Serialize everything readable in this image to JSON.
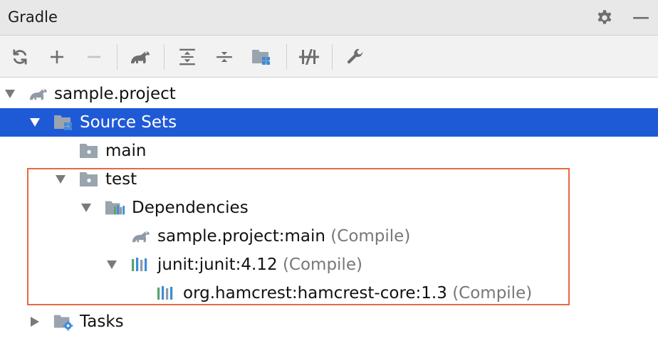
{
  "header": {
    "title": "Gradle",
    "buttons": [
      {
        "icon": "gear-icon"
      },
      {
        "icon": "minimize-icon"
      }
    ]
  },
  "toolbar": {
    "buttons": [
      {
        "icon": "refresh-icon"
      },
      {
        "icon": "add-icon"
      },
      {
        "icon": "remove-icon"
      },
      {
        "icon": "gradle-elephant-icon"
      },
      {
        "icon": "expand-all-icon"
      },
      {
        "icon": "collapse-all-icon"
      },
      {
        "icon": "group-modules-icon"
      },
      {
        "icon": "offline-mode-icon"
      },
      {
        "icon": "wrench-icon"
      }
    ]
  },
  "colors": {
    "selection": "#1f5ad6",
    "highlight_border": "#e8683f",
    "icon_gray": "#8f9aa6",
    "icon_blue": "#3f8bd8",
    "icon_green": "#5aa36c"
  },
  "tree": [
    {
      "label": "sample.project",
      "scope": "",
      "icon": "gradle-elephant-icon",
      "arrow": "expanded",
      "depth": 0
    },
    {
      "label": "Source Sets",
      "scope": "",
      "icon": "source-sets-folder-icon",
      "arrow": "expanded",
      "depth": 1,
      "selected": true
    },
    {
      "label": "main",
      "scope": "",
      "icon": "folder-icon",
      "arrow": "none",
      "depth": 2
    },
    {
      "label": "test",
      "scope": "",
      "icon": "folder-icon",
      "arrow": "expanded",
      "depth": 2
    },
    {
      "label": "Dependencies",
      "scope": "",
      "icon": "dependencies-folder-icon",
      "arrow": "expanded",
      "depth": 3
    },
    {
      "label": "sample.project:main",
      "scope": "(Compile)",
      "icon": "gradle-elephant-icon",
      "arrow": "none",
      "depth": 4
    },
    {
      "label": "junit:junit:4.12",
      "scope": "(Compile)",
      "icon": "library-icon",
      "arrow": "expanded",
      "depth": 4
    },
    {
      "label": "org.hamcrest:hamcrest-core:1.3",
      "scope": "(Compile)",
      "icon": "library-icon",
      "arrow": "none",
      "depth": 5
    },
    {
      "label": "Tasks",
      "scope": "",
      "icon": "tasks-folder-icon",
      "arrow": "collapsed",
      "depth": 1
    }
  ]
}
